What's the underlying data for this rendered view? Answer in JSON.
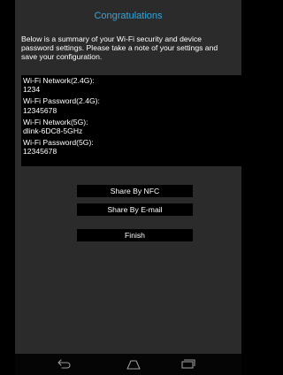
{
  "title": "Congratulations",
  "summary_lines": [
    "Below is a summary of your Wi-Fi security and device",
    "password settings. Please take a note of your settings and",
    "save your configuration."
  ],
  "settings": [
    {
      "label": "Wi-Fi Network(2.4G):",
      "value": "1234"
    },
    {
      "label": "Wi-Fi Password(2.4G):",
      "value": "12345678"
    },
    {
      "label": "Wi-Fi Network(5G):",
      "value": "dlink-6DC8-5GHz"
    },
    {
      "label": "Wi-Fi Password(5G):",
      "value": "12345678"
    }
  ],
  "buttons": {
    "share_nfc": "Share By NFC",
    "share_email": "Share By E-mail",
    "finish": "Finish"
  },
  "colors": {
    "title": "#2ea7e0",
    "background": "#2b2b2b",
    "panel": "#000000"
  },
  "navbar": {
    "icons": [
      "back-icon",
      "home-icon",
      "recent-apps-icon"
    ]
  }
}
